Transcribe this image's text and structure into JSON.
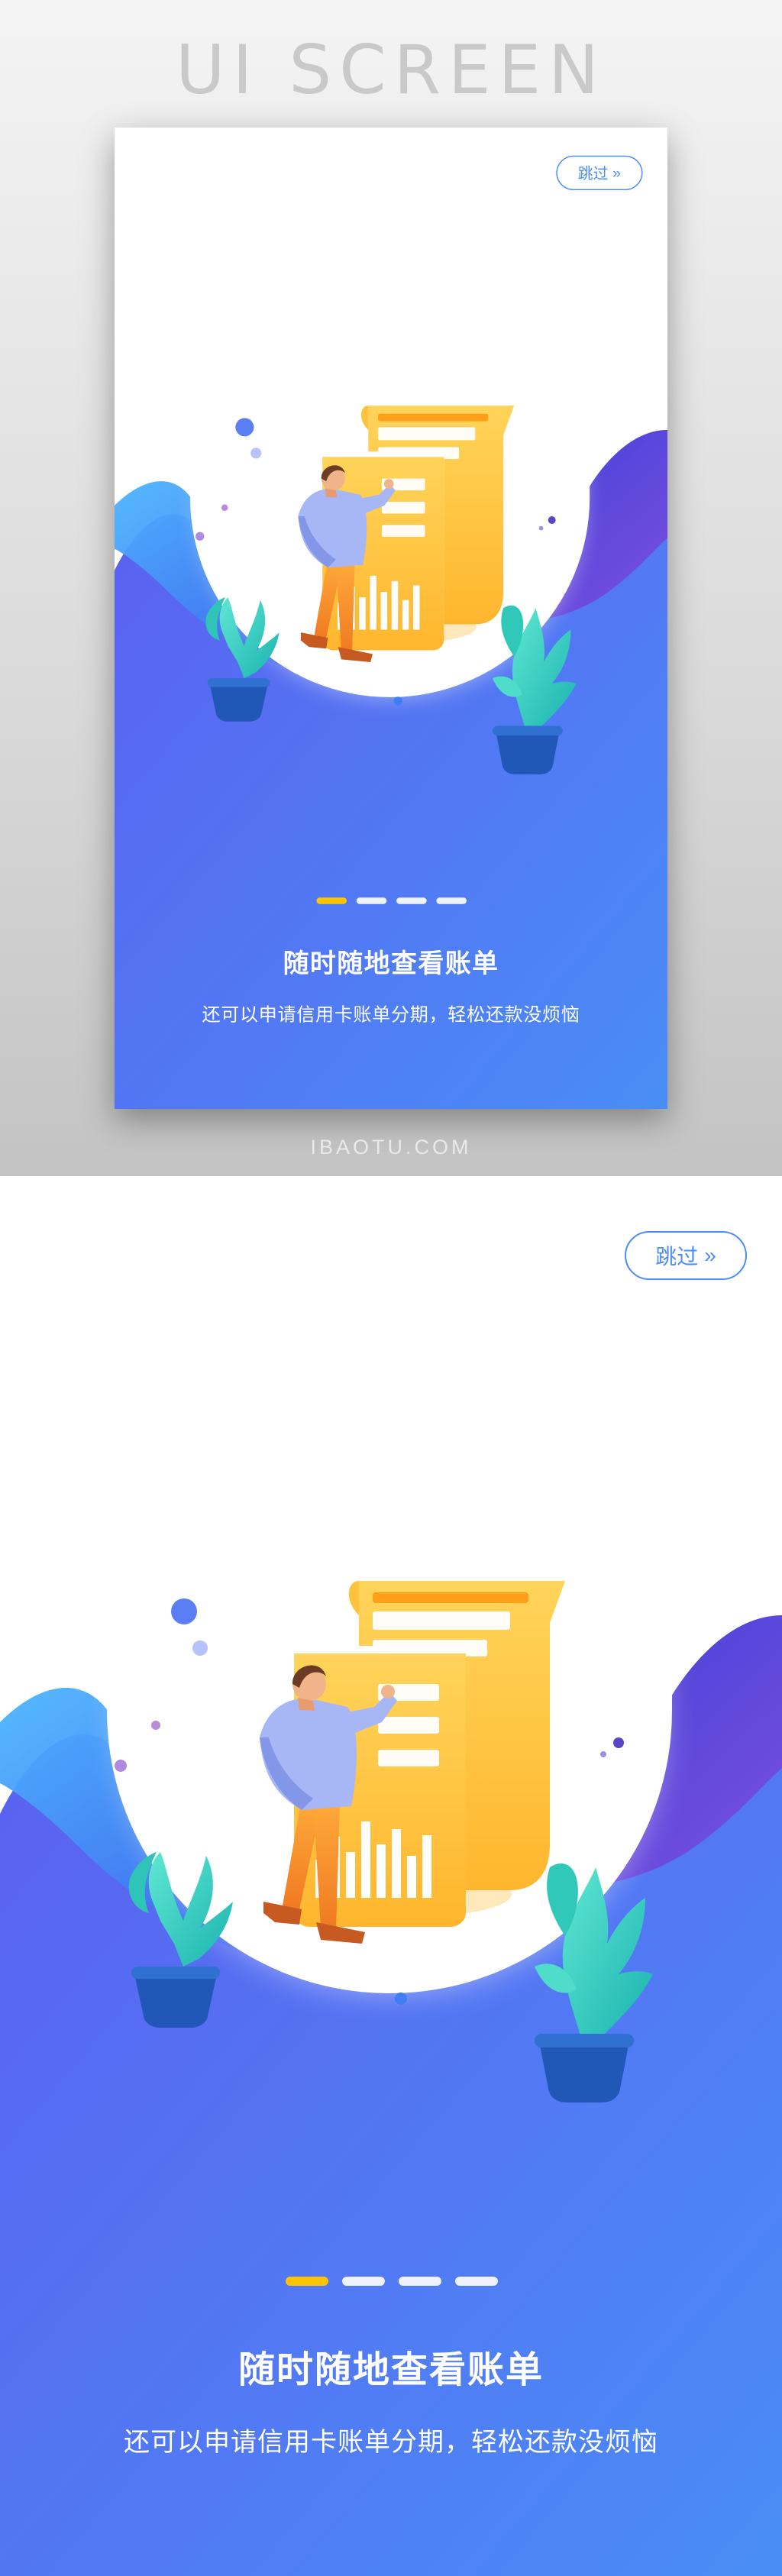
{
  "preview": {
    "title": "UI SCREEN",
    "watermark": "IBAOTU.COM"
  },
  "screen": {
    "skip_label": "跳过",
    "skip_icon": "double-chevron-right-icon",
    "pager": {
      "count": 4,
      "active_index": 0
    },
    "headline": "随时随地查看账单",
    "subline": "还可以申请信用卡账单分期，轻松还款没烦恼",
    "illustration": "man-pointing-at-bill-illustration"
  },
  "colors": {
    "accent_blue": "#4a8df6",
    "gradient_top": "#5b5ff0",
    "gradient_bottom": "#4a8df6",
    "bill_yellow": "#ffc94a",
    "pager_active": "#ffc400",
    "plant_teal": "#3fd6c6"
  }
}
